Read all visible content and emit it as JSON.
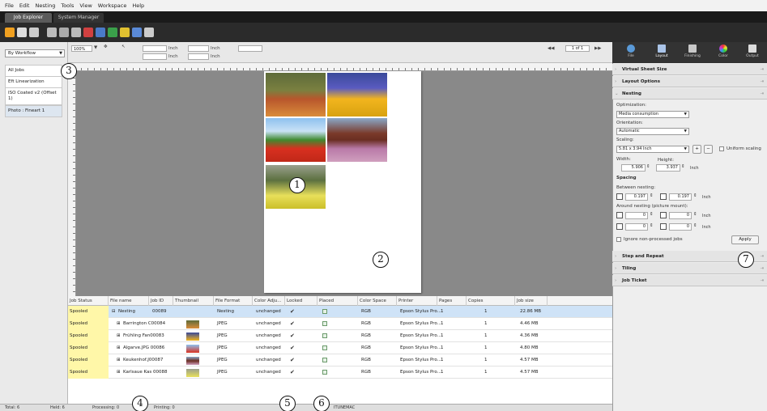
{
  "menu": [
    "File",
    "Edit",
    "Nesting",
    "Tools",
    "View",
    "Workspace",
    "Help"
  ],
  "tabs": [
    "Job Explorer",
    "System Manager"
  ],
  "left_panel": {
    "workflow_select": "By Workflow",
    "jobs": [
      "All Jobs",
      "Eft Linearization",
      "ISO Coated v2 (Offset 1)",
      "Photo : Fineart 1"
    ]
  },
  "view_toolbar": {
    "zoom": "100%",
    "unit1": "Inch",
    "unit2": "Inch",
    "unit3": "Inch",
    "unit4": "Inch",
    "page_indicator": "1 of 1"
  },
  "markers": [
    "1",
    "2",
    "3",
    "4",
    "5",
    "6",
    "7"
  ],
  "table": {
    "columns": [
      "Job Status",
      "File name",
      "Job ID",
      "Thumbnail",
      "File Format",
      "Color Adju...",
      "Locked",
      "Placed",
      "Color Space",
      "Printer",
      "Pages",
      "Copies",
      "Job size"
    ],
    "rows": [
      {
        "status": "Spooled",
        "file": "Nesting",
        "id": "00089",
        "format": "Nesting",
        "color": "unchanged",
        "space": "RGB",
        "printer": "Epson Stylus Pro...",
        "pages": "1",
        "copies": "1",
        "size": "22.86 MB"
      },
      {
        "status": "Spooled",
        "file": "Barrington C00084",
        "id": "",
        "format": "JPEG",
        "color": "unchanged",
        "space": "RGB",
        "printer": "Epson Stylus Pro...",
        "pages": "1",
        "copies": "1",
        "size": "4.46 MB"
      },
      {
        "status": "Spooled",
        "file": "Frühling Fan00083",
        "id": "",
        "format": "JPEG",
        "color": "unchanged",
        "space": "RGB",
        "printer": "Epson Stylus Pro...",
        "pages": "1",
        "copies": "1",
        "size": "4.36 MB"
      },
      {
        "status": "Spooled",
        "file": "Algarve.JPG 00086",
        "id": "",
        "format": "JPEG",
        "color": "unchanged",
        "space": "RGB",
        "printer": "Epson Stylus Pro...",
        "pages": "1",
        "copies": "1",
        "size": "4.80 MB"
      },
      {
        "status": "Spooled",
        "file": "Keukenhof.J00087",
        "id": "",
        "format": "JPEG",
        "color": "unchanged",
        "space": "RGB",
        "printer": "Epson Stylus Pro...",
        "pages": "1",
        "copies": "1",
        "size": "4.57 MB"
      },
      {
        "status": "Spooled",
        "file": "Karlsaue Kas 00088",
        "id": "",
        "format": "JPEG",
        "color": "unchanged",
        "space": "RGB",
        "printer": "Epson Stylus Pro...",
        "pages": "1",
        "copies": "1",
        "size": "4.57 MB"
      }
    ]
  },
  "status_bar": {
    "total": "Total: 6",
    "held": "Held: 6",
    "processing": "Processing: 0",
    "printing": "Printing: 0",
    "right_text": "ITUNEMAC"
  },
  "right_panel": {
    "icons": [
      "File",
      "Layout",
      "Finishing",
      "Color",
      "Output"
    ],
    "sections": {
      "virtual_sheet": "Virtual Sheet Size",
      "layout_options": "Layout Options",
      "nesting": "Nesting",
      "step_repeat": "Step and Repeat",
      "tiling": "Tiling",
      "job_ticket": "Job Ticket"
    },
    "nesting": {
      "optimization_label": "Optimization:",
      "optimization_value": "Media consumption",
      "orientation_label": "Orientation:",
      "orientation_value": "Automatic",
      "scaling_label": "Scaling:",
      "scaling_value": "5.81 x 3.94 Inch",
      "uniform_scaling": "Uniform scaling",
      "width_label": "Width:",
      "height_label": "Height:",
      "width_value": "5.906",
      "height_value": "3.937",
      "unit": "Inch",
      "spacing_label": "Spacing",
      "between_label": "Between nesting:",
      "between_h": "0.197",
      "between_v": "0.197",
      "around_label": "Around nesting (picture mount):",
      "around_top": "0",
      "around_left": "0",
      "around_bottom": "0",
      "around_right": "0",
      "ignore_label": "Ignore non-processed jobs",
      "apply": "Apply"
    }
  },
  "colors": {
    "status_yellow": "#fff7a8",
    "selected_row": "#cfe3f7",
    "canvas_gray": "#898989"
  }
}
